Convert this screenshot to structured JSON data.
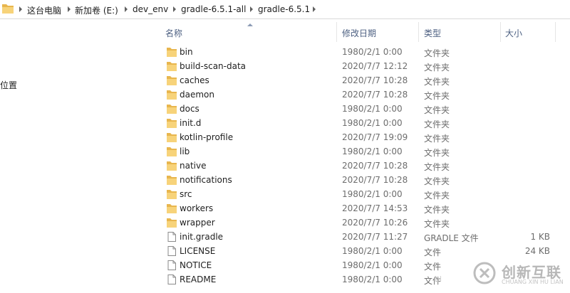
{
  "breadcrumb": {
    "items": [
      "这台电脑",
      "新加卷 (E:)",
      "dev_env",
      "gradle-6.5.1-all",
      "gradle-6.5.1"
    ],
    "icon": "folder-icon"
  },
  "navpane": {
    "location_label": "位置"
  },
  "columns": {
    "name": "名称",
    "modified": "修改日期",
    "type": "类型",
    "size": "大小",
    "sorted_by": "name"
  },
  "files": [
    {
      "name": "bin",
      "modified": "1980/2/1 0:00",
      "type": "文件夹",
      "size": "",
      "icon": "folder-icon"
    },
    {
      "name": "build-scan-data",
      "modified": "2020/7/7 12:12",
      "type": "文件夹",
      "size": "",
      "icon": "folder-icon"
    },
    {
      "name": "caches",
      "modified": "2020/7/7 10:28",
      "type": "文件夹",
      "size": "",
      "icon": "folder-icon"
    },
    {
      "name": "daemon",
      "modified": "2020/7/7 10:28",
      "type": "文件夹",
      "size": "",
      "icon": "folder-icon"
    },
    {
      "name": "docs",
      "modified": "1980/2/1 0:00",
      "type": "文件夹",
      "size": "",
      "icon": "folder-icon"
    },
    {
      "name": "init.d",
      "modified": "1980/2/1 0:00",
      "type": "文件夹",
      "size": "",
      "icon": "folder-icon"
    },
    {
      "name": "kotlin-profile",
      "modified": "2020/7/7 19:09",
      "type": "文件夹",
      "size": "",
      "icon": "folder-icon"
    },
    {
      "name": "lib",
      "modified": "1980/2/1 0:00",
      "type": "文件夹",
      "size": "",
      "icon": "folder-icon"
    },
    {
      "name": "native",
      "modified": "2020/7/7 10:28",
      "type": "文件夹",
      "size": "",
      "icon": "folder-icon"
    },
    {
      "name": "notifications",
      "modified": "2020/7/7 10:28",
      "type": "文件夹",
      "size": "",
      "icon": "folder-icon"
    },
    {
      "name": "src",
      "modified": "1980/2/1 0:00",
      "type": "文件夹",
      "size": "",
      "icon": "folder-icon"
    },
    {
      "name": "workers",
      "modified": "2020/7/7 14:53",
      "type": "文件夹",
      "size": "",
      "icon": "folder-icon"
    },
    {
      "name": "wrapper",
      "modified": "2020/7/7 10:26",
      "type": "文件夹",
      "size": "",
      "icon": "folder-icon"
    },
    {
      "name": "init.gradle",
      "modified": "2020/7/7 11:27",
      "type": "GRADLE 文件",
      "size": "1 KB",
      "icon": "file-icon"
    },
    {
      "name": "LICENSE",
      "modified": "1980/2/1 0:00",
      "type": "文件",
      "size": "24 KB",
      "icon": "file-icon"
    },
    {
      "name": "NOTICE",
      "modified": "1980/2/1 0:00",
      "type": "文件",
      "size": "",
      "icon": "file-icon"
    },
    {
      "name": "README",
      "modified": "1980/2/1 0:00",
      "type": "文件",
      "size": "",
      "icon": "file-icon"
    }
  ],
  "watermark": {
    "brand": "创新互联",
    "subtitle": "CHUANG XIN HU LIAN",
    "url_fragment": "bl"
  }
}
